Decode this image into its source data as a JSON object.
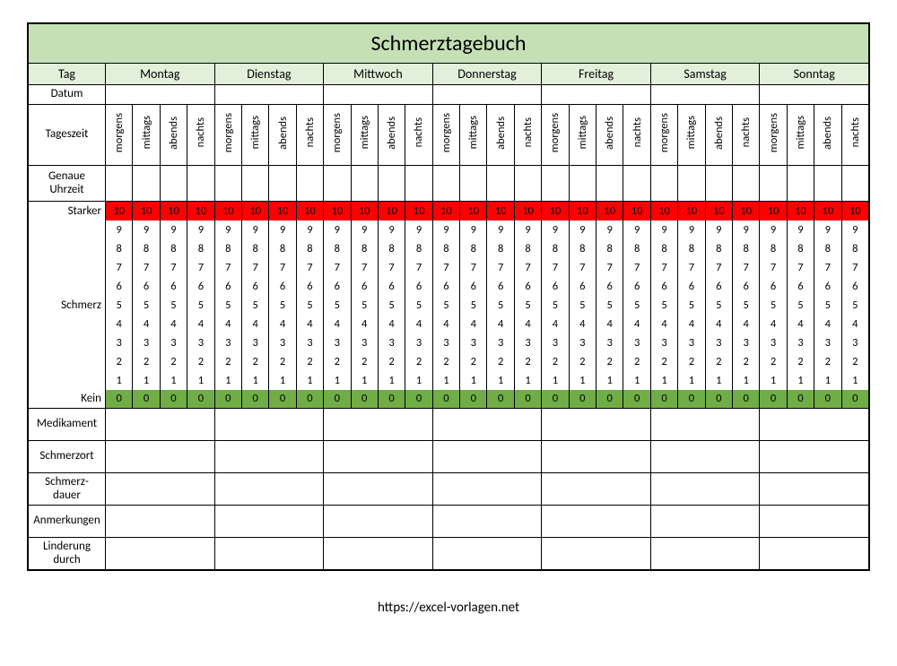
{
  "title": "Schmerztagebuch",
  "row_tag": "Tag",
  "days": [
    "Montag",
    "Dienstag",
    "Mittwoch",
    "Donnerstag",
    "Freitag",
    "Samstag",
    "Sonntag"
  ],
  "row_datum": "Datum",
  "row_tageszeit": "Tageszeit",
  "times_of_day": [
    "morgens",
    "mittags",
    "abends",
    "nachts"
  ],
  "row_uhrzeit": "Genaue Uhrzeit",
  "scale_top_label": "Starker",
  "scale_mid_label": "Schmerz",
  "scale_bottom_label": "Kein",
  "scale_values": [
    "10",
    "9",
    "8",
    "7",
    "6",
    "5",
    "4",
    "3",
    "2",
    "1",
    "0"
  ],
  "bottom_rows": [
    "Medikament",
    "Schmerzort",
    "Schmerz-\ndauer",
    "Anmerkungen",
    "Linderung durch"
  ],
  "footer": "https://excel-vorlagen.net"
}
